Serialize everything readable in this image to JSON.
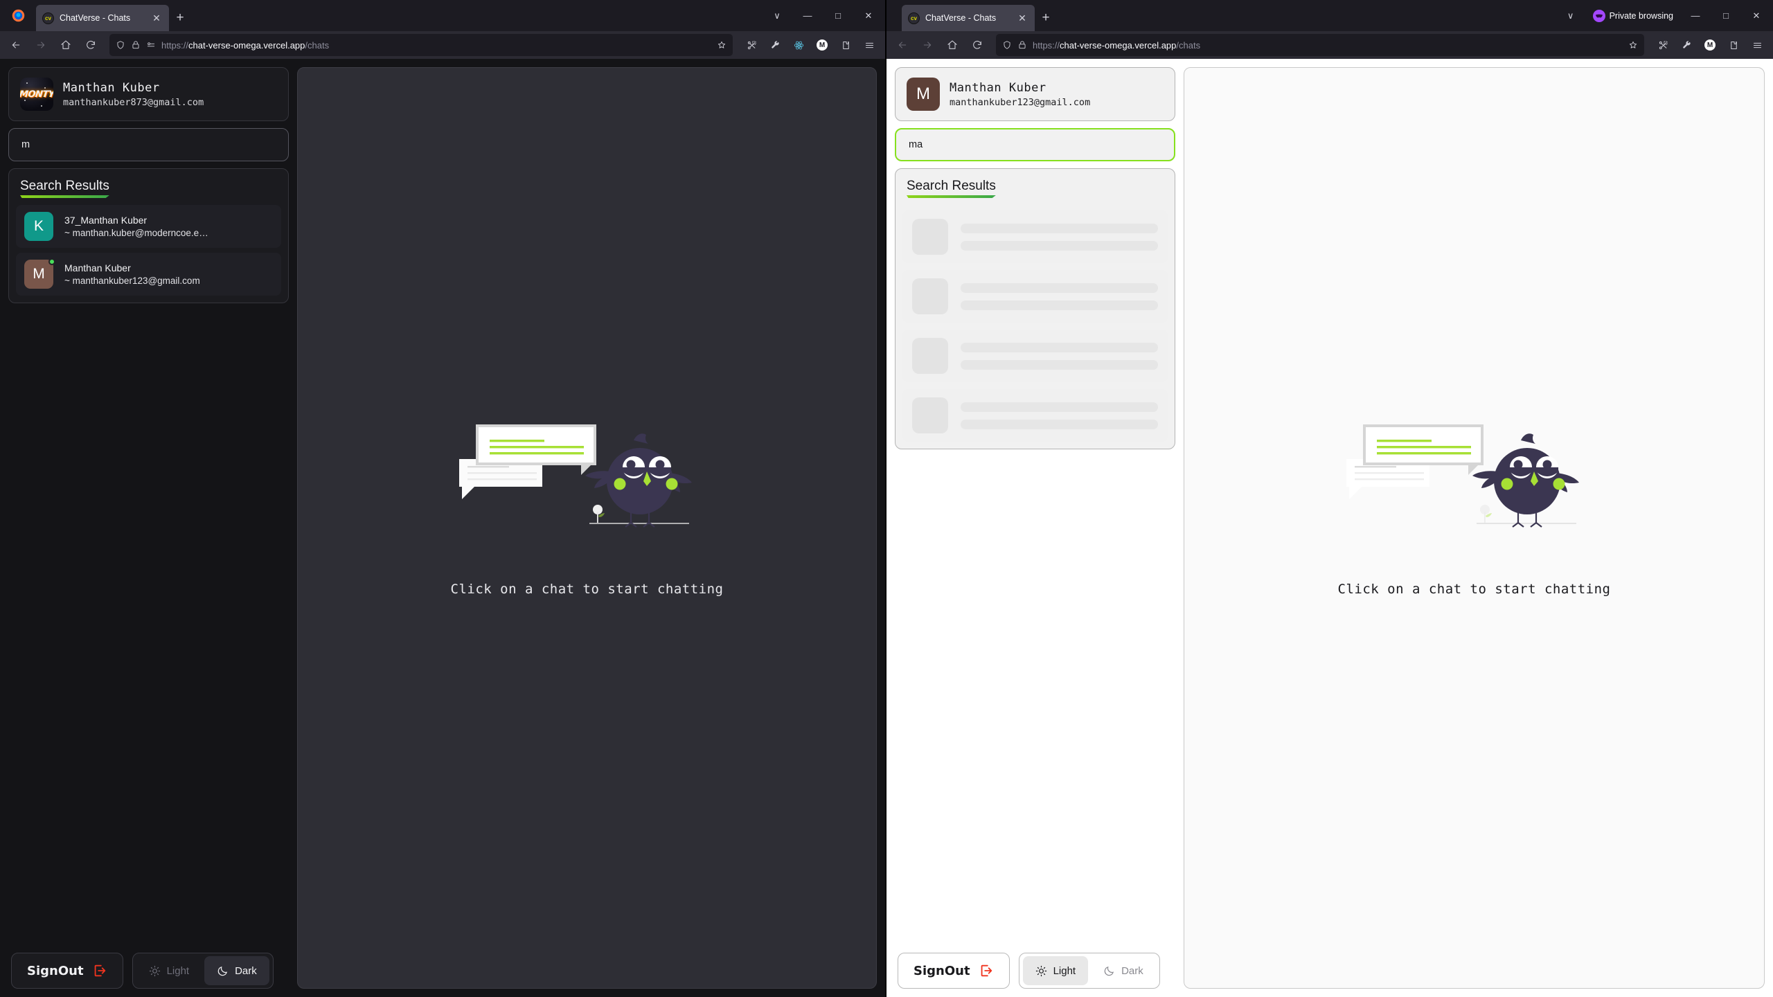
{
  "browser": {
    "left": {
      "tab": {
        "favicon_text": "cv",
        "title": "ChatVerse - Chats",
        "close_label": "✕"
      },
      "newtab_label": "+",
      "window_controls": {
        "list_tabs": "∨",
        "minimize": "—",
        "maximize": "□",
        "close": "✕"
      },
      "url": {
        "scheme": "https://",
        "host": "chat-verse-omega.vercel.app",
        "path": "/chats"
      },
      "toolbar_icons": [
        "shield-icon",
        "lock-icon",
        "permissions-icon"
      ],
      "extension_icons": [
        "bookmark-star-icon",
        "screenshot-scissors-icon",
        "wrench-icon",
        "react-devtools-icon",
        "metamask-avatar-icon",
        "extensions-icon",
        "app-menu-icon"
      ],
      "avatar_initial": "M"
    },
    "right": {
      "tab": {
        "favicon_text": "cv",
        "title": "ChatVerse - Chats",
        "close_label": "✕"
      },
      "newtab_label": "+",
      "private_label": "Private browsing",
      "window_controls": {
        "list_tabs": "∨",
        "minimize": "—",
        "maximize": "□",
        "close": "✕"
      },
      "url": {
        "scheme": "https://",
        "host": "chat-verse-omega.vercel.app",
        "path": "/chats"
      },
      "toolbar_icons": [
        "shield-icon",
        "lock-icon"
      ],
      "extension_icons": [
        "bookmark-star-icon",
        "screenshot-scissors-icon",
        "wrench-icon",
        "metamask-avatar-icon",
        "extensions-icon",
        "app-menu-icon"
      ],
      "avatar_initial": "M"
    }
  },
  "app": {
    "left": {
      "theme": "dark",
      "profile": {
        "name": "Manthan Kuber",
        "email": "manthankuber873@gmail.com",
        "avatar_type": "image",
        "avatar_text": "MONTY"
      },
      "search": {
        "value": "m",
        "placeholder": ""
      },
      "results": {
        "title": "Search Results",
        "state": "loaded",
        "items": [
          {
            "initial": "K",
            "avatar_color": "#10998a",
            "name": "37_Manthan Kuber",
            "email": "~ manthan.kuber@moderncoe.e…",
            "online": false
          },
          {
            "initial": "M",
            "avatar_color": "#79564a",
            "name": "Manthan Kuber",
            "email": "~ manthankuber123@gmail.com",
            "online": true
          }
        ]
      },
      "empty_state": {
        "text": "Click on a chat to start chatting"
      },
      "bottom": {
        "signout_label": "SignOut",
        "theme_light_label": "Light",
        "theme_dark_label": "Dark",
        "active_theme": "Dark"
      }
    },
    "right": {
      "theme": "light",
      "profile": {
        "name": "Manthan Kuber",
        "email": "manthankuber123@gmail.com",
        "avatar_type": "letter",
        "avatar_text": "M",
        "avatar_color": "#5d4037"
      },
      "search": {
        "value": "ma",
        "placeholder": ""
      },
      "results": {
        "title": "Search Results",
        "state": "loading",
        "skeleton_count": 4,
        "items": []
      },
      "empty_state": {
        "text": "Click on a chat to start chatting"
      },
      "bottom": {
        "signout_label": "SignOut",
        "theme_light_label": "Light",
        "theme_dark_label": "Dark",
        "active_theme": "Light"
      }
    }
  },
  "colors": {
    "accent_green": "#86e01e",
    "underline_from": "#8fd41a",
    "underline_to": "#3aa84a",
    "signout_red": "#f0341f",
    "online_green": "#4ade5a",
    "bird_body": "#3b3651",
    "private_purple": "#a347ff"
  }
}
